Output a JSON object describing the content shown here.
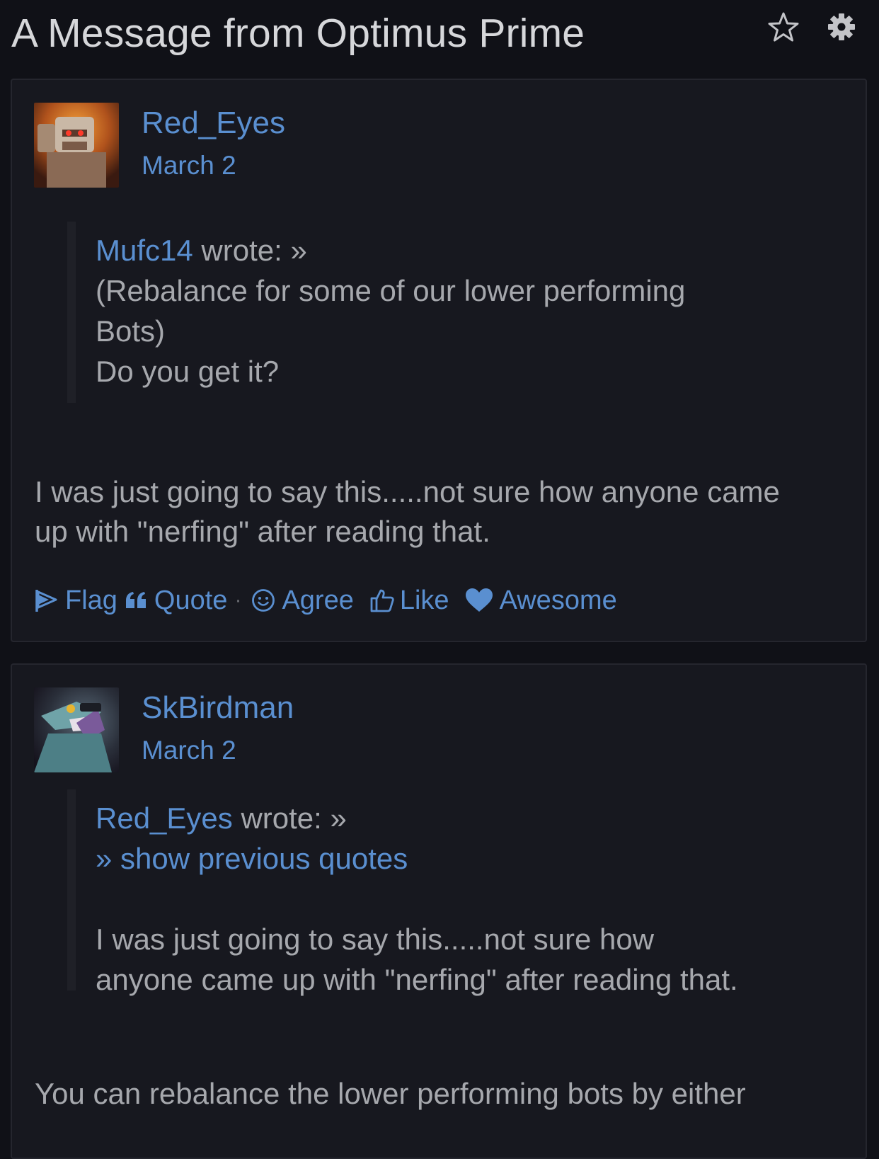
{
  "header": {
    "title": "A Message from Optimus Prime",
    "icons": [
      "star-icon",
      "gear-icon"
    ]
  },
  "posts": [
    {
      "author": "Red_Eyes",
      "date": "March 2",
      "quote": {
        "author": "Mufc14",
        "wrote": "wrote: »",
        "lines": [
          "(Rebalance for some of our lower performing",
          "Bots)",
          "Do you get it?"
        ]
      },
      "body": [
        "I was just going to say this.....not sure how anyone came",
        "up with \"nerfing\" after reading that."
      ],
      "actions": {
        "flag": "Flag",
        "quote": "Quote",
        "separator": "·",
        "agree": "Agree",
        "like": "Like",
        "awesome": "Awesome"
      }
    },
    {
      "author": "SkBirdman",
      "date": "March 2",
      "quote": {
        "author": "Red_Eyes",
        "wrote": "wrote: »",
        "show_previous": "» show previous quotes",
        "lines": [
          "I was just going to say this.....not sure how",
          "anyone came up with \"nerfing\" after reading that."
        ]
      },
      "body": [
        "You can rebalance the lower performing bots by either"
      ]
    }
  ],
  "colors": {
    "background": "#101117",
    "card": "#17181f",
    "link": "#5a8fd0",
    "text": "#a6a8ad",
    "title": "#d6d7da"
  }
}
